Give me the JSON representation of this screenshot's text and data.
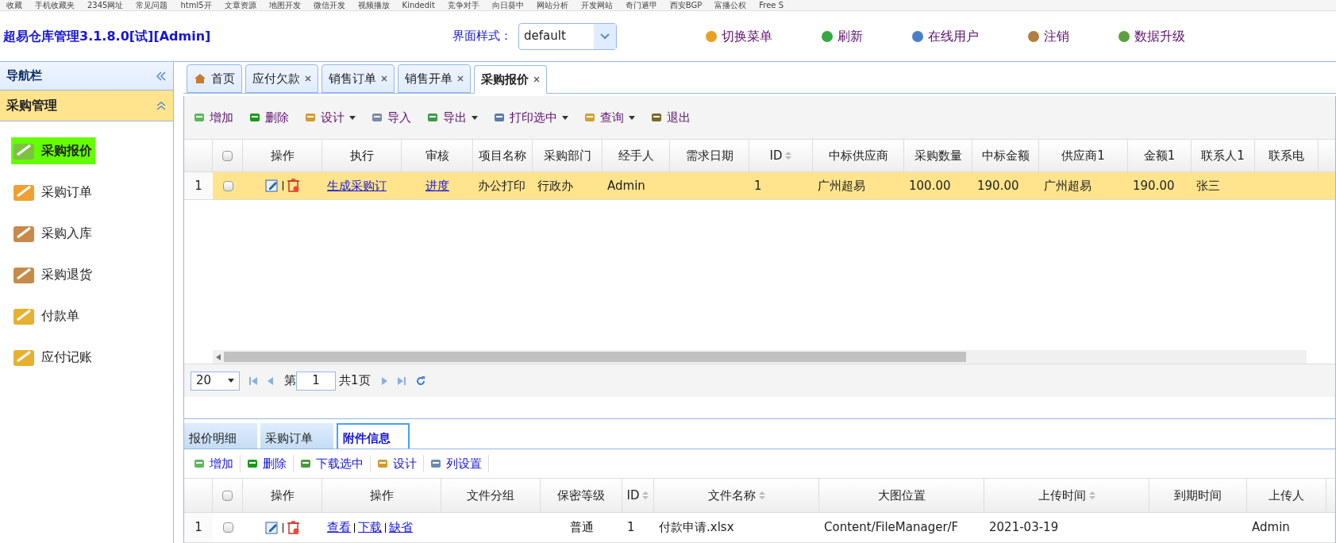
{
  "bookmarks": [
    "收藏",
    "手机收藏夹",
    "2345网址",
    "常见问题",
    "html5开",
    "文章资源",
    "地图开发",
    "微信开发",
    "视频播放",
    "Kindedit",
    "竞争对手",
    "向日葵中",
    "网站分析",
    "开发网站",
    "奇门遁甲",
    "西安BGP",
    "富播公权",
    "Free S"
  ],
  "header": {
    "title": "超易仓库管理3.1.8.0[试][Admin]",
    "style_label": "界面样式：",
    "style_value": "default",
    "actions": [
      "切换菜单",
      "刷新",
      "在线用户",
      "注销",
      "数据升级"
    ]
  },
  "sidebar": {
    "title": "导航栏",
    "group": "采购管理",
    "items": [
      {
        "label": "采购报价",
        "selected": true
      },
      {
        "label": "采购订单",
        "selected": false
      },
      {
        "label": "采购入库",
        "selected": false
      },
      {
        "label": "采购退货",
        "selected": false
      },
      {
        "label": "付款单",
        "selected": false
      },
      {
        "label": "应付记账",
        "selected": false
      }
    ]
  },
  "tabs": [
    {
      "label": "首页",
      "closable": false,
      "selected": false
    },
    {
      "label": "应付欠款",
      "closable": true,
      "selected": false
    },
    {
      "label": "销售订单",
      "closable": true,
      "selected": false
    },
    {
      "label": "销售开单",
      "closable": true,
      "selected": false
    },
    {
      "label": "采购报价",
      "closable": true,
      "selected": true
    }
  ],
  "toolbar": [
    {
      "label": "增加",
      "dropdown": false
    },
    {
      "label": "删除",
      "dropdown": false
    },
    {
      "label": "设计",
      "dropdown": true
    },
    {
      "label": "导入",
      "dropdown": false
    },
    {
      "label": "导出",
      "dropdown": true
    },
    {
      "label": "打印选中",
      "dropdown": true
    },
    {
      "label": "查询",
      "dropdown": true
    },
    {
      "label": "退出",
      "dropdown": false
    }
  ],
  "table": {
    "all_checked": false,
    "columns": [
      {
        "label": "操作",
        "kind": "actions",
        "sortable": false
      },
      {
        "label": "执行",
        "kind": "link",
        "sortable": false
      },
      {
        "label": "审核",
        "kind": "link",
        "sortable": false
      },
      {
        "label": "项目名称",
        "kind": "text",
        "sortable": false
      },
      {
        "label": "采购部门",
        "kind": "text",
        "sortable": false
      },
      {
        "label": "经手人",
        "kind": "text",
        "sortable": false
      },
      {
        "label": "需求日期",
        "kind": "text",
        "sortable": false
      },
      {
        "label": "ID",
        "kind": "text",
        "sortable": true
      },
      {
        "label": "中标供应商",
        "kind": "text",
        "sortable": false
      },
      {
        "label": "采购数量",
        "kind": "text",
        "sortable": false
      },
      {
        "label": "中标金额",
        "kind": "text",
        "sortable": false
      },
      {
        "label": "供应商1",
        "kind": "text",
        "sortable": false
      },
      {
        "label": "金额1",
        "kind": "text",
        "sortable": false
      },
      {
        "label": "联系人1",
        "kind": "text",
        "sortable": false
      },
      {
        "label": "联系电",
        "kind": "text",
        "sortable": false
      }
    ],
    "rows": [
      {
        "index": "1",
        "checked": false,
        "selected": true,
        "cells": [
          null,
          "生成采购订",
          "进度",
          "办公打印",
          "行政办",
          "Admin",
          null,
          "1",
          "广州超易",
          "100.00",
          "190.00",
          "广州超易",
          "190.00",
          "张三",
          null
        ]
      }
    ]
  },
  "pager": {
    "page_size": "20",
    "page_label": "第",
    "page": "1",
    "total": "共1页"
  },
  "detail": {
    "tabs": [
      {
        "label": "报价明细",
        "selected": false
      },
      {
        "label": "采购订单",
        "selected": false
      },
      {
        "label": "附件信息",
        "selected": true
      }
    ],
    "toolbar": [
      "增加",
      "删除",
      "下载选中",
      "设计",
      "列设置"
    ],
    "all_checked": false,
    "columns": [
      {
        "label": "操作",
        "kind": "actions",
        "sortable": false
      },
      {
        "label": "操作",
        "kind": "links",
        "sortable": false
      },
      {
        "label": "文件分组",
        "kind": "text",
        "sortable": false
      },
      {
        "label": "保密等级",
        "kind": "center",
        "sortable": false
      },
      {
        "label": "ID",
        "kind": "text",
        "sortable": true
      },
      {
        "label": "文件名称",
        "kind": "text",
        "sortable": true
      },
      {
        "label": "大图位置",
        "kind": "text",
        "sortable": false
      },
      {
        "label": "上传时间",
        "kind": "text",
        "sortable": true
      },
      {
        "label": "到期时间",
        "kind": "text",
        "sortable": false
      },
      {
        "label": "上传人",
        "kind": "text",
        "sortable": false
      }
    ],
    "rows": [
      {
        "index": "1",
        "checked": false,
        "cells": [
          null,
          [
            "查看",
            "下载",
            "缺省"
          ],
          null,
          "普通",
          "1",
          "付款申请.xlsx",
          "Content/FileManager/F",
          "2021-03-19",
          null,
          "Admin"
        ]
      }
    ]
  }
}
